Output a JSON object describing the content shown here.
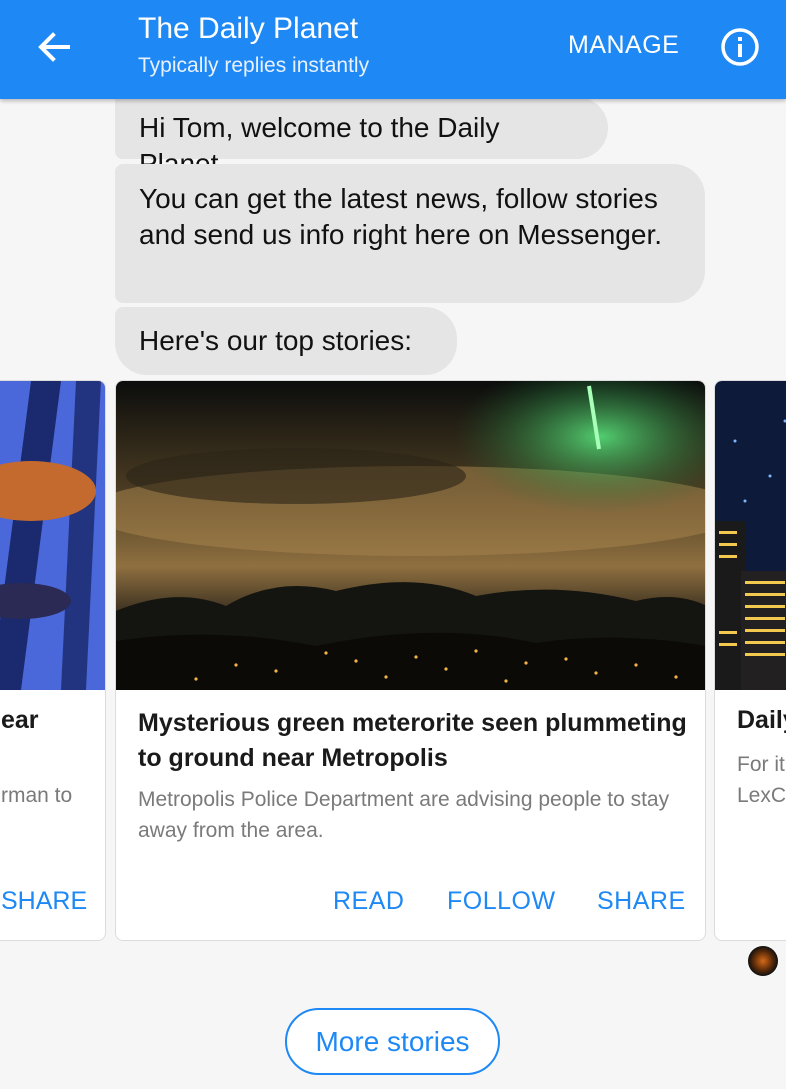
{
  "header": {
    "title": "The Daily Planet",
    "subtitle": "Typically replies instantly",
    "manage_label": "MANAGE",
    "back_icon": "arrow-left-icon",
    "info_icon": "info-icon",
    "color": "#1e88f5"
  },
  "messages": [
    "Hi Tom, welcome to the Daily Planet.",
    "You can get the latest news, follow stories and send us info right here on Messenger.",
    "Here's our top stories:"
  ],
  "cards": {
    "left": {
      "title_fragment": "ear",
      "subtitle_fragment": "rman to",
      "share_label": "SHARE"
    },
    "main": {
      "title": "Mysterious green meterorite seen plummeting to ground near Metropolis",
      "subtitle": "Metropolis Police Department are advising people to stay away from the area.",
      "read_label": "READ",
      "follow_label": "FOLLOW",
      "share_label": "SHARE"
    },
    "right": {
      "title_fragment": "Daily",
      "subtitle_line1": "For it",
      "subtitle_line2": "LexC"
    }
  },
  "more_stories_label": "More stories",
  "accent_color": "#1e88f5"
}
